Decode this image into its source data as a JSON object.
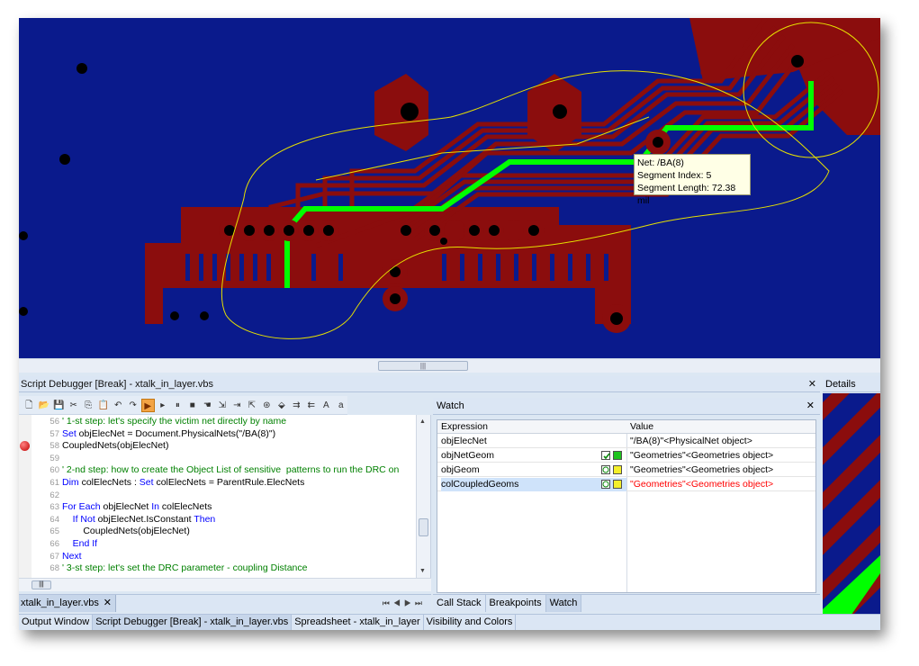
{
  "tooltip": {
    "net": "Net: /BA(8)",
    "segment_index": "Segment Index: 5",
    "segment_length": "Segment Length: 72.38 mil"
  },
  "debugger": {
    "title": "Script Debugger [Break] - xtalk_in_layer.vbs",
    "close": "✕"
  },
  "details": {
    "title": "Details"
  },
  "code": {
    "lines": [
      {
        "n": "56",
        "text": "' 1-st step: let's specify the victim net directly by name"
      },
      {
        "n": "57",
        "kw": "Set",
        "text": " objElecNet = Document.PhysicalNets(\"/BA(8)\")"
      },
      {
        "n": "58",
        "text": "CoupledNets(objElecNet)"
      },
      {
        "n": "59",
        "text": ""
      },
      {
        "n": "60",
        "text": "' 2-nd step: how to create the Object List of sensitive  patterns to run the DRC on"
      },
      {
        "n": "61",
        "kw": "Dim",
        "text": " colElecNets : ",
        "kw2": "Set",
        "text2": " colElecNets = ParentRule.ElecNets"
      },
      {
        "n": "62",
        "text": ""
      },
      {
        "n": "63",
        "kw": "For Each",
        "text": " objElecNet ",
        "kw2": "In",
        "text2": " colElecNets"
      },
      {
        "n": "64",
        "kw": "    If Not",
        "text": " objElecNet.IsConstant ",
        "kw2": "Then",
        "text2": ""
      },
      {
        "n": "65",
        "text": "        CoupledNets(objElecNet)"
      },
      {
        "n": "66",
        "kw": "    End If",
        "text": ""
      },
      {
        "n": "67",
        "kw": "Next",
        "text": ""
      },
      {
        "n": "68",
        "text": "' 3-st step: let's set the DRC parameter - coupling Distance"
      }
    ]
  },
  "file_tab": {
    "name": "xtalk_in_layer.vbs",
    "close": "✕",
    "nav": "⏮◀▶⏭"
  },
  "watch": {
    "title": "Watch",
    "close": "✕",
    "headers": {
      "expression": "Expression",
      "value": "Value"
    },
    "rows": [
      {
        "expr": "objElecNet",
        "value": "\"/BA(8)\"<PhysicalNet object>"
      },
      {
        "expr": "objNetGeom",
        "value": "\"Geometries\"<Geometries object>"
      },
      {
        "expr": "objGeom",
        "value": "\"Geometries\"<Geometries object>"
      },
      {
        "expr": "colCoupledGeoms",
        "value": "\"Geometries\"<Geometries object>"
      }
    ],
    "tabs": [
      "Call Stack",
      "Breakpoints",
      "Watch"
    ]
  },
  "bottom_tabs": [
    "Output Window",
    "Script Debugger [Break] - xtalk_in_layer.vbs",
    "Spreadsheet - xtalk_in_layer",
    "Visibility and Colors"
  ],
  "colors": {
    "board": "#0a1a8c",
    "copper": "#8b0d0d",
    "highlight": "#00ff00",
    "accent_red": "#ff0000"
  }
}
